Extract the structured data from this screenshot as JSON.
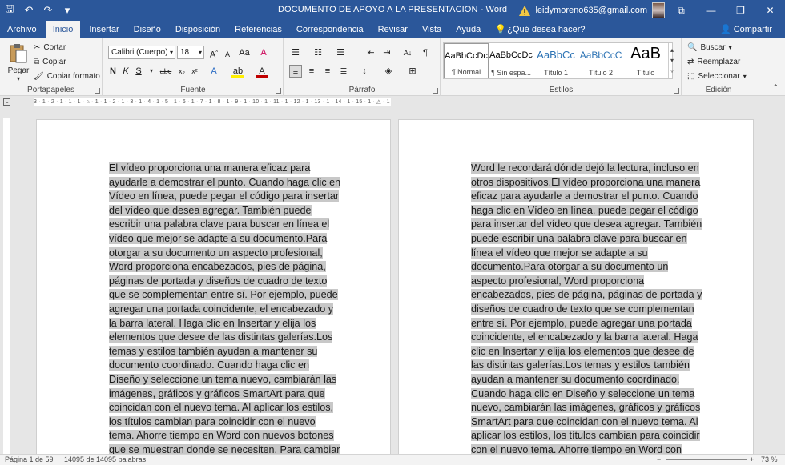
{
  "window": {
    "title": "DOCUMENTO DE APOYO A LA PRESENTACION  -  Word",
    "account": "leidymoreno635@gmail.com",
    "controls": {
      "ribbon_options": "⧉",
      "minimize": "—",
      "restore": "❐",
      "close": "✕"
    }
  },
  "qat": {
    "save": "🖫",
    "undo": "↶",
    "redo": "↷",
    "customize": "▾"
  },
  "tabs": [
    "Archivo",
    "Inicio",
    "Insertar",
    "Diseño",
    "Disposición",
    "Referencias",
    "Correspondencia",
    "Revisar",
    "Vista",
    "Ayuda"
  ],
  "tell_me": "¿Qué desea hacer?",
  "share": "Compartir",
  "clipboard": {
    "paste": "Pegar",
    "cut": "Cortar",
    "copy": "Copiar",
    "format_painter": "Copiar formato",
    "label": "Portapapeles"
  },
  "font": {
    "name": "Calibri (Cuerpo)",
    "size": "18",
    "label": "Fuente"
  },
  "paragraph": {
    "label": "Párrafo"
  },
  "styles": {
    "items": [
      {
        "preview": "AaBbCcDc",
        "name": "¶ Normal"
      },
      {
        "preview": "AaBbCcDc",
        "name": "¶ Sin espa..."
      },
      {
        "preview": "AaBbCc",
        "name": "Título 1"
      },
      {
        "preview": "AaBbCcC",
        "name": "Título 2"
      },
      {
        "preview": "AaB",
        "name": "Título"
      }
    ],
    "label": "Estilos"
  },
  "editing": {
    "find": "Buscar",
    "replace": "Reemplazar",
    "select": "Seleccionar",
    "label": "Edición"
  },
  "ruler": {
    "marks": "3 · 1 · 2 · 1 · 1 · 1 · ⌂ · 1 · 1 · 2 · 1 · 3 · 1 · 4 · 1 · 5 · 1 · 6 · 1 · 7 · 1 · 8 · 1 · 9 · 1 · 10 · 1 · 11 · 1 · 12 · 1 · 13 · 1 · 14 · 1 · 15 · 1 · △ · 1 · 17 · 1 ·"
  },
  "pages": {
    "left": "El vídeo proporciona una manera eficaz para ayudarle a demostrar el punto. Cuando haga clic en Vídeo en línea, puede pegar el código para insertar del vídeo que desea agregar. También puede escribir una palabra clave para buscar en línea el vídeo que mejor se adapte a su documento.Para otorgar a su documento un aspecto profesional, Word proporciona encabezados, pies de página, páginas de portada y diseños de cuadro de texto que se complementan entre sí. Por ejemplo, puede agregar una portada coincidente, el encabezado y la barra lateral. Haga clic en Insertar y elija los elementos que desee de las distintas galerías.Los temas y estilos también ayudan a mantener su documento coordinado. Cuando haga clic en Diseño y seleccione un tema nuevo, cambiarán las imágenes, gráficos y gráficos SmartArt para que coincidan con el nuevo tema. Al aplicar los estilos, los títulos cambian para coincidir con el nuevo tema. Ahorre tiempo en Word con nuevos botones que se muestran donde se necesiten. Para cambiar la forma en que se ajusta",
    "right": "Word le recordará dónde dejó la lectura, incluso en otros dispositivos.El vídeo proporciona una manera eficaz para ayudarle a demostrar el punto. Cuando haga clic en Vídeo en línea, puede pegar el código para insertar del vídeo que desea agregar. También puede escribir una palabra clave para buscar en línea el vídeo que mejor se adapte a su documento.Para otorgar a su documento un aspecto profesional, Word proporciona encabezados, pies de página, páginas de portada y diseños de cuadro de texto que se complementan entre sí. Por ejemplo, puede agregar una portada coincidente, el encabezado y la barra lateral. Haga clic en Insertar y elija los elementos que desee de las distintas galerías.Los temas y estilos también ayudan a mantener su documento coordinado. Cuando haga clic en Diseño y seleccione un tema nuevo, cambiarán las imágenes, gráficos y gráficos SmartArt para que coincidan con el nuevo tema. Al aplicar los estilos, los títulos cambian para coincidir con el nuevo tema. Ahorre tiempo en Word con nuevos botones que se"
  },
  "status": {
    "page": "Página 1 de 59",
    "words": "14095 de 14095 palabras",
    "zoom": "73 %"
  },
  "colors": {
    "accent": "#2b579a",
    "selection": "#c8c8c8",
    "ribbon": "#f3f3f3"
  }
}
